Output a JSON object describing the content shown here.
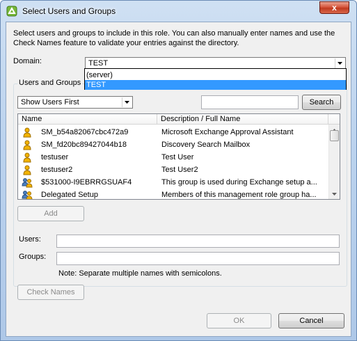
{
  "window": {
    "title": "Select Users and Groups",
    "close_label": "x"
  },
  "dialog": {
    "instructions": "Select users and groups to include in this role. You can also manually enter names and use the Check Names feature to validate your entries against the directory.",
    "domain_label": "Domain:",
    "domain_value": "TEST",
    "domain_options": [
      "(server)",
      "TEST"
    ],
    "group_legend": "Users and Groups",
    "show_filter": "Show Users First",
    "search_value": "",
    "search_label": "Search",
    "columns": [
      "Name",
      "Description / Full Name"
    ],
    "rows": [
      {
        "type": "user",
        "name": "SM_b54a82067cbc472a9",
        "desc": "Microsoft Exchange Approval Assistant"
      },
      {
        "type": "user",
        "name": "SM_fd20bc89427044b18",
        "desc": "Discovery Search Mailbox"
      },
      {
        "type": "user",
        "name": "testuser",
        "desc": "Test User"
      },
      {
        "type": "user",
        "name": "testuser2",
        "desc": "Test User2"
      },
      {
        "type": "group",
        "name": "$531000-I9EBRRGSUAF4",
        "desc": "This group is used during Exchange setup a..."
      },
      {
        "type": "group",
        "name": "Delegated Setup",
        "desc": "Members of this management role group ha..."
      }
    ],
    "add_label": "Add",
    "users_label": "Users:",
    "users_value": "",
    "groups_label": "Groups:",
    "groups_value": "",
    "note": "Note: Separate multiple names with semicolons.",
    "check_names_label": "Check Names",
    "ok_label": "OK",
    "cancel_label": "Cancel"
  },
  "colors": {
    "selection": "#3399ff",
    "user_icon": "#f2b300",
    "group_icon_secondary": "#4a7fc0"
  }
}
